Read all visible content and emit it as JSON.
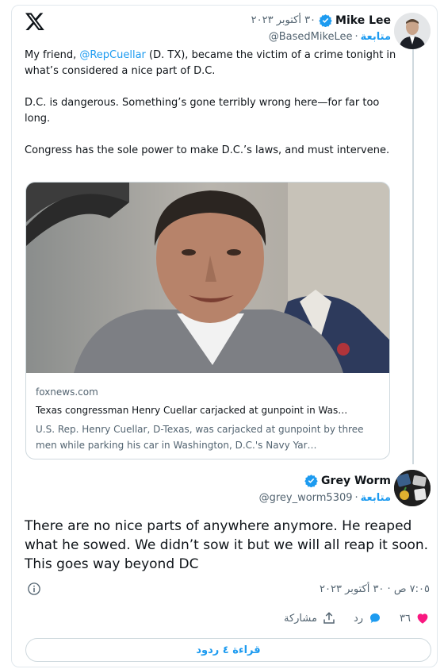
{
  "quoted_tweet": {
    "author_name": "Mike Lee",
    "date": "٣٠ أكتوبر ٢٠٢٣",
    "handle": "@BasedMikeLee",
    "separator": "·",
    "follow_label": "متابعة",
    "text_intro": "My friend, ",
    "mention": "@RepCuellar",
    "text_intro_rest": " (D. TX), became the victim of a crime tonight in what’s considered a nice part of D.C.",
    "paragraph_2": "D.C. is dangerous. Something’s gone terribly wrong here—for far too long.",
    "paragraph_3": "Congress has the sole power to make D.C.’s laws, and must intervene.",
    "card": {
      "domain": "foxnews.com",
      "title": "Texas congressman Henry Cuellar carjacked at gunpoint in Was…",
      "description": "U.S. Rep. Henry Cuellar, D-Texas, was carjacked at gunpoint by three men while parking his car in Washington, D.C.'s Navy Yar…"
    }
  },
  "reply": {
    "author_name": "Grey Worm",
    "handle": "@grey_worm5309",
    "separator": "·",
    "follow_label": "متابعة",
    "text": "There are no nice parts of anywhere anymore. He reaped what he sowed. We didn’t sow it but we will all reap it soon. This goes way beyond DC",
    "timestamp": "٧:٠٥ ص · ٣٠ أكتوبر ٢٠٢٣"
  },
  "actions": {
    "likes": "٣٦",
    "reply_label": "رد",
    "share_label": "مشاركة",
    "read_replies_label": "قراءة ٤ ردود"
  },
  "icons": {
    "logo": "x-logo-icon",
    "verified": "verified-badge-icon",
    "info": "info-icon",
    "like": "heart-icon",
    "reply": "speech-bubble-icon",
    "share": "share-upload-icon"
  },
  "colors": {
    "accent": "#1d9bf0",
    "like": "#f91880",
    "text": "#0f1419",
    "muted": "#536471",
    "border": "#cfd9de"
  }
}
